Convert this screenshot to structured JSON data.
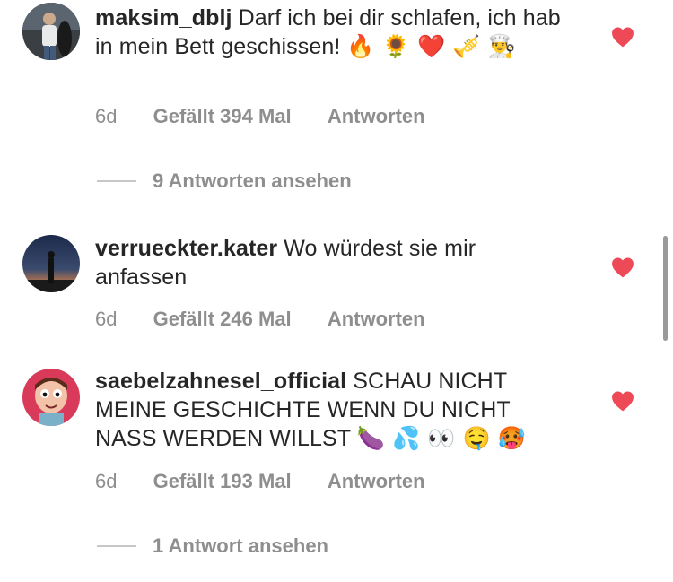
{
  "comments": [
    {
      "username": "maksim_dblj",
      "text": "Darf ich bei dir schlafen, ich hab in mein Bett geschissen!",
      "emojis": "🔥 🌻 ❤️ 🎺 👨‍🍳",
      "age": "6d",
      "likes": "Gefällt 394 Mal",
      "reply": "Antworten",
      "view_replies": "9 Antworten ansehen"
    },
    {
      "username": "verrueckter.kater",
      "text": "Wo würdest sie mir anfassen",
      "age": "6d",
      "likes": "Gefällt 246 Mal",
      "reply": "Antworten"
    },
    {
      "username": "saebelzahnesel_official",
      "text": "SCHAU NICHT MEINE GESCHICHTE WENN DU NICHT NASS WERDEN WILLST",
      "emojis": "🍆 💦 👀 🤤 🥵",
      "age": "6d",
      "likes": "Gefällt 193 Mal",
      "reply": "Antworten",
      "view_replies": "1 Antwort ansehen"
    }
  ],
  "colors": {
    "heart": "#ed4956",
    "meta_text": "#8e8e8e",
    "primary_text": "#262626"
  }
}
